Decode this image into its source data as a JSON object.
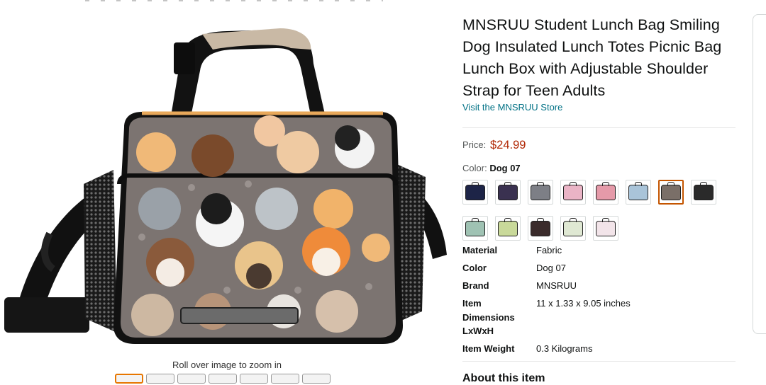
{
  "product": {
    "title": "MNSRUU Student Lunch Bag Smiling Dog Insulated Lunch Totes Picnic Bag Lunch Box with Adjustable Shoulder Strap for Teen Adults",
    "store_link": "Visit the MNSRUU Store",
    "price_label": "Price:",
    "price": "$24.99",
    "color_label": "Color:",
    "color_value": "Dog 07",
    "zoom_hint": "Roll over image to zoom in",
    "about_heading": "About this item"
  },
  "swatches": [
    {
      "name": "navy-space",
      "color": "#1d2447",
      "selected": false
    },
    {
      "name": "purple-cats",
      "color": "#3a3150",
      "selected": false
    },
    {
      "name": "grey-cartoon",
      "color": "#7d7f86",
      "selected": false
    },
    {
      "name": "pink-cats",
      "color": "#eab4c6",
      "selected": false
    },
    {
      "name": "pink-flamingo",
      "color": "#e59aa9",
      "selected": false
    },
    {
      "name": "light-blue",
      "color": "#a9c4d9",
      "selected": false
    },
    {
      "name": "dog-07",
      "color": "#7a6f68",
      "selected": true
    },
    {
      "name": "black-dogs",
      "color": "#2a2a2a",
      "selected": false
    },
    {
      "name": "mint-sloths",
      "color": "#9fc2b3",
      "selected": false
    },
    {
      "name": "green-unicorn",
      "color": "#c9d99a",
      "selected": false
    },
    {
      "name": "black-red-dogs",
      "color": "#3a2b2b",
      "selected": false
    },
    {
      "name": "white-green",
      "color": "#dfe8d3",
      "selected": false
    },
    {
      "name": "white-pink",
      "color": "#f2e4e9",
      "selected": false
    }
  ],
  "specs": [
    {
      "key": "Material",
      "value": "Fabric"
    },
    {
      "key": "Color",
      "value": "Dog 07"
    },
    {
      "key": "Brand",
      "value": "MNSRUU"
    },
    {
      "key": "Item Dimensions LxWxH",
      "value": "11 x 1.33 x 9.05 inches"
    },
    {
      "key": "Item Weight",
      "value": "0.3 Kilograms"
    }
  ],
  "colors": {
    "link": "#007185",
    "price": "#b12704",
    "selected_border": "#c45500",
    "bag_bg": "#7c7471"
  }
}
